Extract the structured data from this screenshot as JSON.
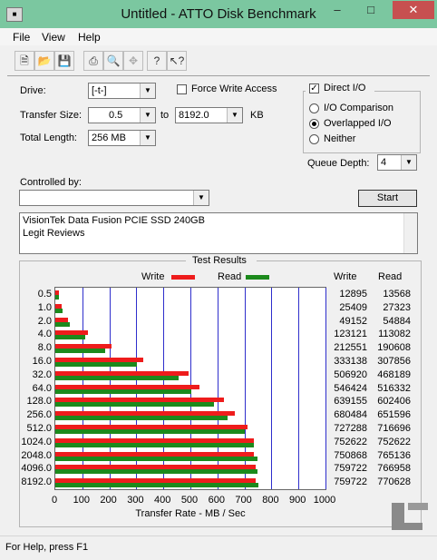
{
  "window": {
    "title": "Untitled - ATTO Disk Benchmark",
    "minimize": "–",
    "maximize": "□",
    "close": "✕",
    "app_icon": "disk-icon"
  },
  "menu": [
    "File",
    "View",
    "Help"
  ],
  "toolbar": [
    "new-icon",
    "open-icon",
    "save-icon",
    "print-icon",
    "print-preview-icon",
    "move-icon",
    "help-icon",
    "context-help-icon"
  ],
  "settings": {
    "drive_label": "Drive:",
    "drive_value": "[-t-]",
    "force_write_access_label": "Force Write Access",
    "force_write_access_checked": false,
    "direct_io_label": "Direct I/O",
    "direct_io_checked": true,
    "transfer_size_label": "Transfer Size:",
    "transfer_size_from": "0.5",
    "to_label": "to",
    "transfer_size_to": "8192.0",
    "kb_label": "KB",
    "total_length_label": "Total Length:",
    "total_length_value": "256 MB",
    "io_comparison_label": "I/O Comparison",
    "overlapped_io_label": "Overlapped I/O",
    "neither_label": "Neither",
    "io_mode_selected": "Overlapped I/O",
    "queue_depth_label": "Queue Depth:",
    "queue_depth_value": "4",
    "controlled_by_label": "Controlled by:",
    "controlled_by_value": "",
    "start_label": "Start"
  },
  "description": [
    "VisionTek Data Fusion PCIE SSD 240GB",
    "Legit Reviews"
  ],
  "results": {
    "title": "Test Results",
    "write_col": "Write",
    "read_col": "Read"
  },
  "colors": {
    "write": "#ee1c1c",
    "read": "#1c8a1c",
    "gridline": "#2e2ecc"
  },
  "chart_data": {
    "type": "bar",
    "orientation": "horizontal",
    "xlabel": "Transfer Rate - MB / Sec",
    "xlim": [
      0,
      1000
    ],
    "xticks": [
      "0",
      "100",
      "200",
      "300",
      "400",
      "500",
      "600",
      "700",
      "800",
      "900",
      "1000"
    ],
    "grid": true,
    "legend_placement": "top",
    "categories": [
      "0.5",
      "1.0",
      "2.0",
      "4.0",
      "8.0",
      "16.0",
      "32.0",
      "64.0",
      "128.0",
      "256.0",
      "512.0",
      "1024.0",
      "2048.0",
      "4096.0",
      "8192.0"
    ],
    "series": [
      {
        "name": "Write",
        "values": [
          12.6,
          24.8,
          48.0,
          120.2,
          207.6,
          325.3,
          494.7,
          533.6,
          624.2,
          664.3,
          710.2,
          734.9,
          733.3,
          741.9,
          741.9
        ]
      },
      {
        "name": "Read",
        "values": [
          13.3,
          26.7,
          53.6,
          110.4,
          186.1,
          300.6,
          457.1,
          504.2,
          588.4,
          636.3,
          699.9,
          734.9,
          747.2,
          749.0,
          752.6
        ]
      }
    ],
    "table": {
      "write": [
        "12895",
        "25409",
        "49152",
        "123121",
        "212551",
        "333138",
        "506920",
        "546424",
        "639155",
        "680484",
        "727288",
        "752622",
        "750868",
        "759722",
        "759722"
      ],
      "read": [
        "13568",
        "27323",
        "54884",
        "113082",
        "190608",
        "307856",
        "468189",
        "516332",
        "602406",
        "651596",
        "716696",
        "752622",
        "765136",
        "766958",
        "770628"
      ]
    }
  },
  "status": "For Help, press F1",
  "watermark": "LEGIT"
}
